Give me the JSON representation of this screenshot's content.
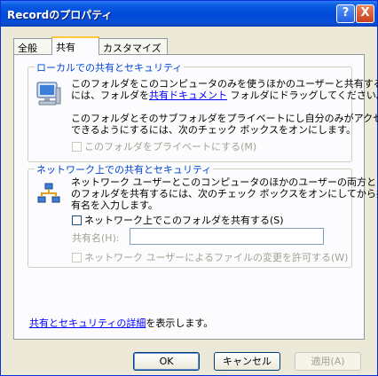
{
  "window": {
    "title": "Recordのプロパティ",
    "help_symbol": "?",
    "close_symbol": "X"
  },
  "tabs": [
    {
      "label": "全般",
      "active": false
    },
    {
      "label": "共有",
      "active": true
    },
    {
      "label": "カスタマイズ",
      "active": false
    }
  ],
  "local": {
    "legend": "ローカルでの共有とセキュリティ",
    "line1": "このフォルダをこのコンピュータのみを使うほかのユーザーと共有する",
    "line2_pre": "には、フォルダを",
    "line2_link": "共有ドキュメント",
    "line2_post": " フォルダにドラッグしてください。",
    "line3": "このフォルダとそのサブフォルダをプライベートにし自分のみがアクセス",
    "line4": "できるようにするには、次のチェック ボックスをオンにします。",
    "private_checkbox": "このフォルダをプライベートにする(M)"
  },
  "network": {
    "legend": "ネットワーク上での共有とセキュリティ",
    "line1": "ネットワーク ユーザーとこのコンピュータのほかのユーザーの両方とこ",
    "line2": "のフォルダを共有するには、次のチェック ボックスをオンにしてから共",
    "line3": "有名を入力します。",
    "share_checkbox": "ネットワーク上でこのフォルダを共有する(S)",
    "share_name_label": "共有名(H):",
    "share_name_value": "",
    "allow_changes_checkbox": "ネットワーク ユーザーによるファイルの変更を許可する(W)"
  },
  "footer": {
    "link": "共有とセキュリティの詳細",
    "suffix": "を表示します。"
  },
  "buttons": {
    "ok": "OK",
    "cancel": "キャンセル",
    "apply": "適用(A)"
  }
}
